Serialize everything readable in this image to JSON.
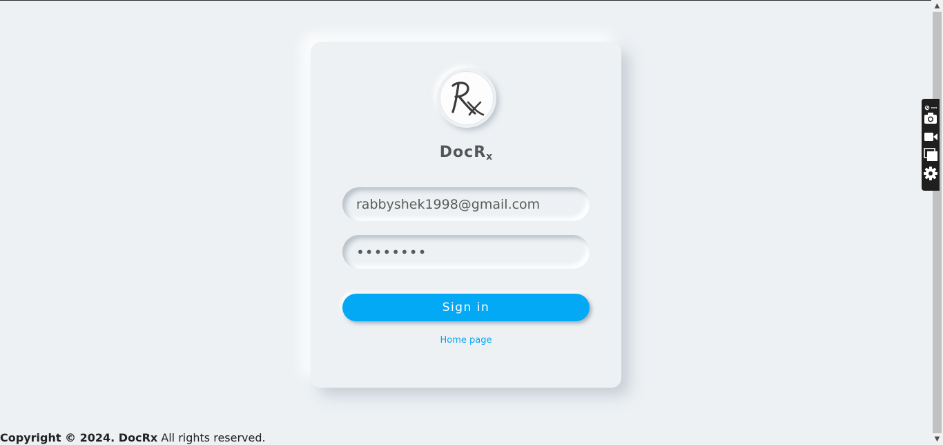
{
  "app": {
    "brand_main": "DocR",
    "brand_sub": "x"
  },
  "login": {
    "email_value": "rabbyshek1998@gmail.com",
    "password_value": "••••••••",
    "sign_in_label": "Sign in",
    "home_link_label": "Home page"
  },
  "footer": {
    "copyright_bold": "Copyright © 2024. DocRx",
    "copyright_rest": " All rights reserved."
  },
  "toolbar": {
    "icons": [
      "link-icon",
      "more-icon",
      "camera-icon",
      "video-icon",
      "window-icon",
      "settings-icon"
    ]
  },
  "colors": {
    "background": "#edf1f4",
    "accent": "#03a9f4",
    "text": "#555555"
  }
}
